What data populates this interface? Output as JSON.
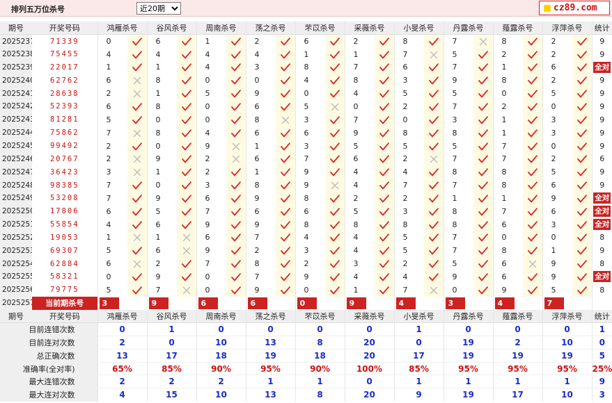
{
  "header": {
    "title": "排列五万位杀号",
    "period_select": "近20期",
    "logo_text": "cz89.com"
  },
  "columns": {
    "period": "期号",
    "draw": "开奖号码",
    "total": "统计",
    "killers": [
      "鸿雁杀号",
      "谷风杀号",
      "周南杀号",
      "荡之杀号",
      "芣苡杀号",
      "采薇杀号",
      "小旻杀号",
      "丹露杀号",
      "薤露杀号",
      "浮萍杀号"
    ]
  },
  "rows": [
    {
      "period": "2025237",
      "draw": "71339",
      "k": [
        [
          0,
          1
        ],
        [
          6,
          1
        ],
        [
          1,
          1
        ],
        [
          2,
          1
        ],
        [
          6,
          1
        ],
        [
          2,
          1
        ],
        [
          8,
          1
        ],
        [
          7,
          0
        ],
        [
          8,
          1
        ],
        [
          2,
          1
        ]
      ],
      "total": "9"
    },
    {
      "period": "2025238",
      "draw": "75455",
      "k": [
        [
          4,
          1
        ],
        [
          4,
          1
        ],
        [
          4,
          1
        ],
        [
          4,
          1
        ],
        [
          1,
          1
        ],
        [
          1,
          1
        ],
        [
          7,
          0
        ],
        [
          5,
          1
        ],
        [
          2,
          1
        ],
        [
          2,
          1
        ]
      ],
      "total": "9"
    },
    {
      "period": "2025239",
      "draw": "22017",
      "k": [
        [
          1,
          1
        ],
        [
          1,
          1
        ],
        [
          4,
          1
        ],
        [
          3,
          1
        ],
        [
          8,
          1
        ],
        [
          7,
          1
        ],
        [
          6,
          1
        ],
        [
          7,
          1
        ],
        [
          1,
          1
        ],
        [
          6,
          1
        ]
      ],
      "total": "全对"
    },
    {
      "period": "2025240",
      "draw": "62762",
      "k": [
        [
          6,
          0
        ],
        [
          8,
          1
        ],
        [
          0,
          1
        ],
        [
          0,
          1
        ],
        [
          4,
          1
        ],
        [
          8,
          1
        ],
        [
          3,
          1
        ],
        [
          9,
          1
        ],
        [
          8,
          1
        ],
        [
          2,
          1
        ]
      ],
      "total": "9"
    },
    {
      "period": "2025241",
      "draw": "28638",
      "k": [
        [
          2,
          0
        ],
        [
          1,
          1
        ],
        [
          5,
          1
        ],
        [
          9,
          1
        ],
        [
          0,
          1
        ],
        [
          4,
          1
        ],
        [
          5,
          1
        ],
        [
          5,
          1
        ],
        [
          0,
          1
        ],
        [
          5,
          1
        ]
      ],
      "total": "9"
    },
    {
      "period": "2025242",
      "draw": "52393",
      "k": [
        [
          6,
          1
        ],
        [
          8,
          1
        ],
        [
          0,
          1
        ],
        [
          6,
          1
        ],
        [
          5,
          0
        ],
        [
          0,
          1
        ],
        [
          2,
          1
        ],
        [
          7,
          1
        ],
        [
          2,
          1
        ],
        [
          0,
          1
        ]
      ],
      "total": "9"
    },
    {
      "period": "2025243",
      "draw": "81281",
      "k": [
        [
          5,
          1
        ],
        [
          0,
          1
        ],
        [
          0,
          1
        ],
        [
          8,
          0
        ],
        [
          3,
          1
        ],
        [
          7,
          1
        ],
        [
          0,
          1
        ],
        [
          3,
          1
        ],
        [
          1,
          1
        ],
        [
          3,
          1
        ]
      ],
      "total": "9"
    },
    {
      "period": "2025244",
      "draw": "75862",
      "k": [
        [
          7,
          0
        ],
        [
          8,
          1
        ],
        [
          4,
          1
        ],
        [
          6,
          1
        ],
        [
          6,
          1
        ],
        [
          9,
          1
        ],
        [
          8,
          1
        ],
        [
          8,
          1
        ],
        [
          1,
          1
        ],
        [
          3,
          1
        ]
      ],
      "total": "9"
    },
    {
      "period": "2025245",
      "draw": "99492",
      "k": [
        [
          2,
          1
        ],
        [
          0,
          1
        ],
        [
          9,
          0
        ],
        [
          1,
          1
        ],
        [
          3,
          1
        ],
        [
          5,
          1
        ],
        [
          5,
          1
        ],
        [
          5,
          1
        ],
        [
          7,
          1
        ],
        [
          0,
          1
        ]
      ],
      "total": "9"
    },
    {
      "period": "2025246",
      "draw": "20767",
      "k": [
        [
          2,
          0
        ],
        [
          9,
          1
        ],
        [
          2,
          0
        ],
        [
          6,
          1
        ],
        [
          7,
          1
        ],
        [
          6,
          1
        ],
        [
          2,
          0
        ],
        [
          7,
          1
        ],
        [
          7,
          1
        ],
        [
          2,
          1
        ]
      ],
      "total": "6"
    },
    {
      "period": "2025247",
      "draw": "36423",
      "k": [
        [
          3,
          0
        ],
        [
          1,
          1
        ],
        [
          2,
          1
        ],
        [
          1,
          1
        ],
        [
          9,
          1
        ],
        [
          4,
          1
        ],
        [
          4,
          1
        ],
        [
          8,
          1
        ],
        [
          8,
          1
        ],
        [
          5,
          1
        ]
      ],
      "total": "9"
    },
    {
      "period": "2025248",
      "draw": "98385",
      "k": [
        [
          7,
          1
        ],
        [
          0,
          1
        ],
        [
          3,
          1
        ],
        [
          8,
          1
        ],
        [
          9,
          0
        ],
        [
          4,
          1
        ],
        [
          7,
          1
        ],
        [
          7,
          1
        ],
        [
          8,
          1
        ],
        [
          6,
          1
        ]
      ],
      "total": "9"
    },
    {
      "period": "2025249",
      "draw": "53208",
      "k": [
        [
          7,
          1
        ],
        [
          9,
          1
        ],
        [
          6,
          1
        ],
        [
          9,
          1
        ],
        [
          8,
          1
        ],
        [
          2,
          1
        ],
        [
          2,
          1
        ],
        [
          1,
          1
        ],
        [
          1,
          1
        ],
        [
          9,
          1
        ]
      ],
      "total": "全对"
    },
    {
      "period": "2025250",
      "draw": "17806",
      "k": [
        [
          6,
          1
        ],
        [
          5,
          1
        ],
        [
          7,
          1
        ],
        [
          6,
          1
        ],
        [
          6,
          1
        ],
        [
          5,
          1
        ],
        [
          3,
          1
        ],
        [
          8,
          1
        ],
        [
          7,
          1
        ],
        [
          6,
          1
        ]
      ],
      "total": "全对"
    },
    {
      "period": "2025251",
      "draw": "55854",
      "k": [
        [
          4,
          1
        ],
        [
          6,
          1
        ],
        [
          9,
          1
        ],
        [
          9,
          1
        ],
        [
          8,
          1
        ],
        [
          8,
          1
        ],
        [
          8,
          1
        ],
        [
          8,
          1
        ],
        [
          6,
          1
        ],
        [
          3,
          1
        ]
      ],
      "total": "全对"
    },
    {
      "period": "2025252",
      "draw": "19053",
      "k": [
        [
          1,
          0
        ],
        [
          1,
          0
        ],
        [
          6,
          1
        ],
        [
          7,
          1
        ],
        [
          4,
          1
        ],
        [
          4,
          1
        ],
        [
          5,
          1
        ],
        [
          7,
          1
        ],
        [
          0,
          1
        ],
        [
          0,
          1
        ]
      ],
      "total": "8"
    },
    {
      "period": "2025253",
      "draw": "69307",
      "k": [
        [
          5,
          1
        ],
        [
          6,
          0
        ],
        [
          9,
          1
        ],
        [
          2,
          1
        ],
        [
          3,
          1
        ],
        [
          4,
          1
        ],
        [
          5,
          1
        ],
        [
          7,
          1
        ],
        [
          8,
          1
        ],
        [
          1,
          1
        ]
      ],
      "total": "9"
    },
    {
      "period": "2025254",
      "draw": "62884",
      "k": [
        [
          6,
          0
        ],
        [
          2,
          1
        ],
        [
          7,
          1
        ],
        [
          8,
          1
        ],
        [
          2,
          1
        ],
        [
          3,
          1
        ],
        [
          2,
          1
        ],
        [
          5,
          1
        ],
        [
          6,
          0
        ],
        [
          9,
          1
        ]
      ],
      "total": "8"
    },
    {
      "period": "2025255",
      "draw": "58321",
      "k": [
        [
          0,
          1
        ],
        [
          9,
          1
        ],
        [
          0,
          1
        ],
        [
          7,
          1
        ],
        [
          9,
          1
        ],
        [
          4,
          1
        ],
        [
          4,
          1
        ],
        [
          9,
          1
        ],
        [
          6,
          1
        ],
        [
          9,
          1
        ]
      ],
      "total": "全对"
    },
    {
      "period": "2025256",
      "draw": "79775",
      "k": [
        [
          5,
          1
        ],
        [
          7,
          0
        ],
        [
          0,
          1
        ],
        [
          9,
          1
        ],
        [
          0,
          1
        ],
        [
          1,
          1
        ],
        [
          7,
          0
        ],
        [
          0,
          1
        ],
        [
          9,
          1
        ],
        [
          5,
          1
        ]
      ],
      "total": "8"
    }
  ],
  "current": {
    "period": "2025257",
    "label": "当前期杀号",
    "kills": [
      "3",
      "9",
      "6",
      "6",
      "0",
      "9",
      "4",
      "3",
      "4",
      "7"
    ]
  },
  "stats": [
    {
      "label": "目前连错次数",
      "values": [
        "0",
        "1",
        "0",
        "0",
        "0",
        "0",
        "1",
        "0",
        "0",
        "0",
        "1"
      ]
    },
    {
      "label": "目前连对次数",
      "values": [
        "2",
        "0",
        "10",
        "13",
        "8",
        "20",
        "0",
        "19",
        "2",
        "10",
        "0"
      ]
    },
    {
      "label": "总正确次数",
      "values": [
        "13",
        "17",
        "18",
        "19",
        "18",
        "20",
        "17",
        "19",
        "19",
        "19",
        "5"
      ]
    },
    {
      "label": "准确率(全对率)",
      "values": [
        "65%",
        "85%",
        "90%",
        "95%",
        "90%",
        "100%",
        "85%",
        "95%",
        "95%",
        "95%",
        "25%"
      ],
      "red": true
    },
    {
      "label": "最大连错次数",
      "values": [
        "2",
        "2",
        "2",
        "1",
        "1",
        "0",
        "1",
        "1",
        "1",
        "1",
        "9"
      ]
    },
    {
      "label": "最大连对次数",
      "values": [
        "4",
        "15",
        "10",
        "13",
        "8",
        "20",
        "9",
        "19",
        "17",
        "10",
        "3"
      ]
    }
  ],
  "colors": {
    "accent": "#cc2222",
    "check": "#dd2222",
    "cross": "#bbbbbb",
    "stat_blue": "#1a2cc9",
    "header_bg": "#efefef",
    "hit_bg": "#fffbe3"
  }
}
